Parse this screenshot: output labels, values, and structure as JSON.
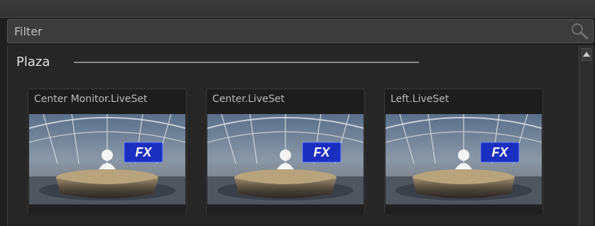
{
  "filter": {
    "placeholder": "Filter"
  },
  "group": {
    "title": "Plaza"
  },
  "cards": [
    {
      "label": "Center Monitor.LiveSet",
      "badge": "FX"
    },
    {
      "label": "Center.LiveSet",
      "badge": "FX"
    },
    {
      "label": "Left.LiveSet",
      "badge": "FX"
    }
  ],
  "icons": {
    "search": "search-icon",
    "scroll_up": "chevron-up-icon"
  },
  "colors": {
    "background": "#262626",
    "badge": "#1a2fbf",
    "text": "#b9b9b9"
  }
}
